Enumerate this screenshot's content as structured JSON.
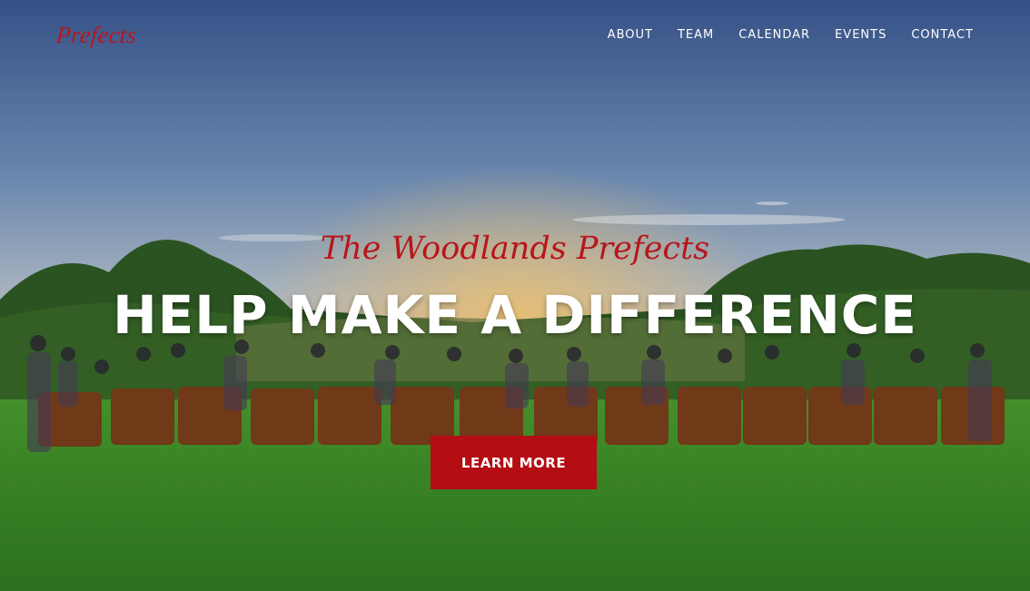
{
  "brand": {
    "name": "Prefects"
  },
  "nav": {
    "items": [
      {
        "label": "ABOUT"
      },
      {
        "label": "TEAM"
      },
      {
        "label": "CALENDAR"
      },
      {
        "label": "EVENTS"
      },
      {
        "label": "CONTACT"
      }
    ]
  },
  "hero": {
    "subtitle": "The Woodlands Prefects",
    "headline": "HELP MAKE A DIFFERENCE",
    "cta_label": "LEARN MORE"
  },
  "colors": {
    "accent": "#b40d13",
    "sky_top": "#3f5d95",
    "sky_mid": "#b8c6d4",
    "sunset": "#e8a25a",
    "grass": "#3f8f2a",
    "foliage": "#2f5a24",
    "chair": "#7a3e1a"
  }
}
